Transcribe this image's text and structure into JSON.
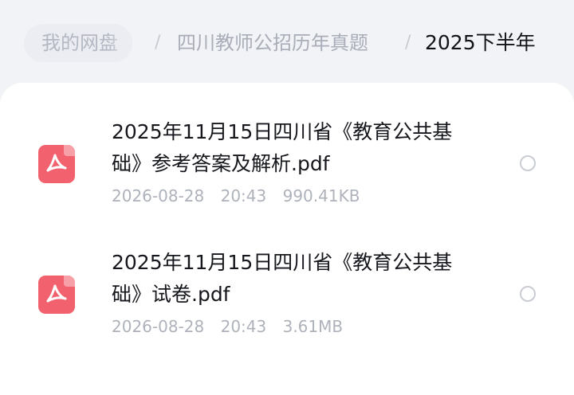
{
  "breadcrumb": {
    "root": "我的网盘",
    "separator": "/",
    "middle": "四川教师公招历年真题",
    "current": "2025下半年"
  },
  "files": [
    {
      "name": "2025年11月15日四川省《教育公共基础》参考答案及解析.pdf",
      "name_line1": "2025年11月15日四川省《教育公共基",
      "name_line2": "础》参考答案及解析.pdf",
      "date": "2026-08-28",
      "time": "20:43",
      "size": "990.41KB",
      "icon": "pdf-icon",
      "selected": false
    },
    {
      "name": "2025年11月15日四川省《教育公共基础》试卷.pdf",
      "name_line1": "2025年11月15日四川省《教育公共基",
      "name_line2": "础》试卷.pdf",
      "date": "2026-08-28",
      "time": "20:43",
      "size": "3.61MB",
      "icon": "pdf-icon",
      "selected": false
    }
  ],
  "colors": {
    "background": "#f2f3f7",
    "card": "#ffffff",
    "pdf_icon": "#f2626e",
    "meta_text": "#aeb2bb"
  }
}
